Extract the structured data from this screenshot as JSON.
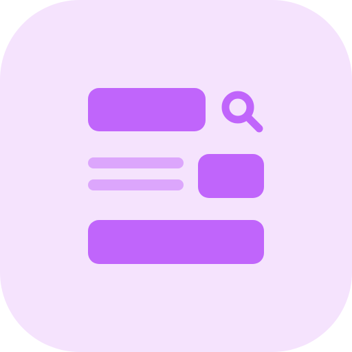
{
  "icon": {
    "name": "search-results-icon",
    "background_color": "#f5e3fd",
    "primary_color": "#c065fb",
    "secondary_color": "#dca6fc",
    "glyph": "search-icon"
  }
}
